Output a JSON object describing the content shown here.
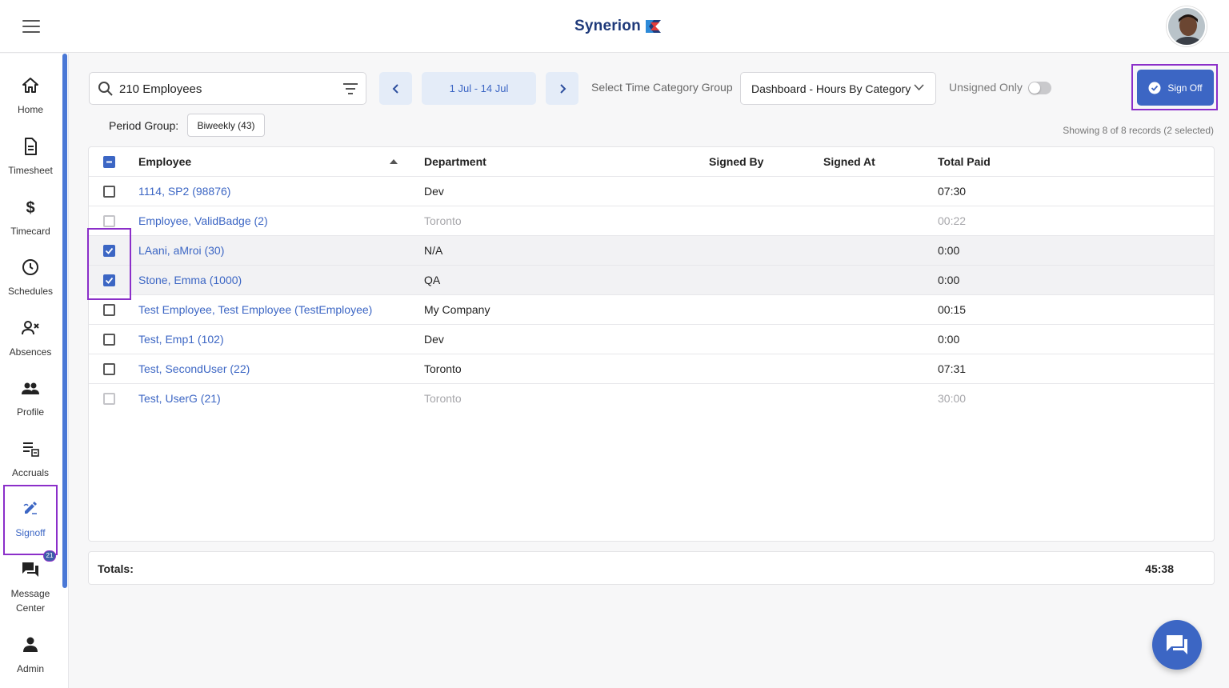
{
  "app": {
    "brand": "Synerion",
    "colors": {
      "accent": "#3c66c4",
      "highlight": "#8b2fc9",
      "link": "#3c66c4"
    }
  },
  "sidebar": {
    "items": [
      {
        "label": "Home",
        "icon": "home-icon"
      },
      {
        "label": "Timesheet",
        "icon": "document-icon"
      },
      {
        "label": "Timecard",
        "icon": "dollar-icon"
      },
      {
        "label": "Schedules",
        "icon": "clock-icon"
      },
      {
        "label": "Absences",
        "icon": "person-x-icon"
      },
      {
        "label": "Profile",
        "icon": "people-icon"
      },
      {
        "label": "Accruals",
        "icon": "accruals-icon"
      },
      {
        "label": "Signoff",
        "icon": "pen-icon"
      },
      {
        "label": "Message Center",
        "icon": "chat-icon"
      },
      {
        "label": "Admin",
        "icon": "person-icon"
      }
    ],
    "signoff_badge": "21"
  },
  "toolbar": {
    "search_value": "210 Employees",
    "date_range": "1 Jul - 14 Jul",
    "time_category_label": "Select Time Category Group",
    "time_category_value": "Dashboard - Hours By Category",
    "unsigned_only_label": "Unsigned Only",
    "unsigned_only_on": false,
    "sign_off_label": "Sign Off",
    "period_group_label": "Period Group:",
    "period_group_value": "Biweekly (43)",
    "records_info": "Showing 8 of 8 records (2 selected)"
  },
  "table": {
    "columns": [
      "Employee",
      "Department",
      "Signed By",
      "Signed At",
      "Total Paid"
    ],
    "rows": [
      {
        "employee": "1114, SP2 (98876)",
        "department": "Dev",
        "signed_by": "",
        "signed_at": "",
        "total_paid": "07:30",
        "checked": false,
        "disabled": false
      },
      {
        "employee": "Employee, ValidBadge (2)",
        "department": "Toronto",
        "signed_by": "",
        "signed_at": "",
        "total_paid": "00:22",
        "checked": false,
        "disabled": true
      },
      {
        "employee": "LAani, aMroi (30)",
        "department": "N/A",
        "signed_by": "",
        "signed_at": "",
        "total_paid": "0:00",
        "checked": true,
        "disabled": false
      },
      {
        "employee": "Stone, Emma (1000)",
        "department": "QA",
        "signed_by": "",
        "signed_at": "",
        "total_paid": "0:00",
        "checked": true,
        "disabled": false
      },
      {
        "employee": "Test Employee, Test Employee (TestEmployee)",
        "department": "My Company",
        "signed_by": "",
        "signed_at": "",
        "total_paid": "00:15",
        "checked": false,
        "disabled": false
      },
      {
        "employee": "Test, Emp1 (102)",
        "department": "Dev",
        "signed_by": "",
        "signed_at": "",
        "total_paid": "0:00",
        "checked": false,
        "disabled": false
      },
      {
        "employee": "Test, SecondUser (22)",
        "department": "Toronto",
        "signed_by": "",
        "signed_at": "",
        "total_paid": "07:31",
        "checked": false,
        "disabled": false
      },
      {
        "employee": "Test, UserG (21)",
        "department": "Toronto",
        "signed_by": "",
        "signed_at": "",
        "total_paid": "30:00",
        "checked": false,
        "disabled": true
      }
    ]
  },
  "totals": {
    "label": "Totals:",
    "value": "45:38"
  }
}
